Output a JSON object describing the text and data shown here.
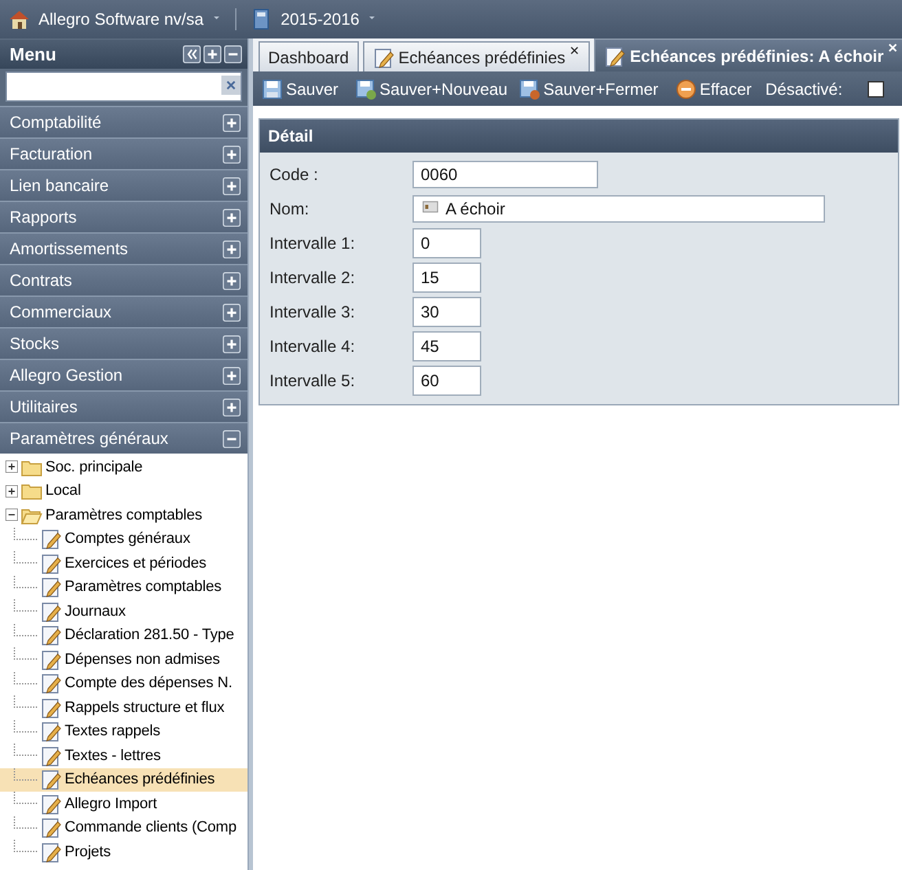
{
  "topbar": {
    "company": "Allegro Software nv/sa",
    "year": "2015-2016"
  },
  "sidebar": {
    "title": "Menu",
    "sections": [
      {
        "label": "Comptabilité",
        "expanded": false
      },
      {
        "label": "Facturation",
        "expanded": false
      },
      {
        "label": "Lien bancaire",
        "expanded": false
      },
      {
        "label": "Rapports",
        "expanded": false
      },
      {
        "label": "Amortissements",
        "expanded": false
      },
      {
        "label": "Contrats",
        "expanded": false
      },
      {
        "label": "Commerciaux",
        "expanded": false
      },
      {
        "label": "Stocks",
        "expanded": false
      },
      {
        "label": "Allegro Gestion",
        "expanded": false
      },
      {
        "label": "Utilitaires",
        "expanded": false
      },
      {
        "label": "Paramètres généraux",
        "expanded": true
      }
    ],
    "tree": [
      {
        "label": "Soc. principale",
        "kind": "folder",
        "expanded": false,
        "selected": false
      },
      {
        "label": "Local",
        "kind": "folder",
        "expanded": false,
        "selected": false
      },
      {
        "label": "Paramètres comptables",
        "kind": "folder",
        "expanded": true,
        "selected": false,
        "children": [
          {
            "label": "Comptes généraux",
            "kind": "leaf",
            "selected": false
          },
          {
            "label": "Exercices et périodes",
            "kind": "leaf",
            "selected": false
          },
          {
            "label": "Paramètres comptables",
            "kind": "leaf",
            "selected": false
          },
          {
            "label": "Journaux",
            "kind": "leaf",
            "selected": false
          },
          {
            "label": "Déclaration 281.50 - Type",
            "kind": "leaf",
            "selected": false
          },
          {
            "label": "Dépenses non admises",
            "kind": "leaf",
            "selected": false
          },
          {
            "label": "Compte des dépenses N.",
            "kind": "leaf",
            "selected": false
          },
          {
            "label": "Rappels structure et flux",
            "kind": "leaf",
            "selected": false
          },
          {
            "label": "Textes rappels",
            "kind": "leaf",
            "selected": false
          },
          {
            "label": "Textes - lettres",
            "kind": "leaf",
            "selected": false
          },
          {
            "label": "Echéances prédéfinies",
            "kind": "leaf",
            "selected": true
          },
          {
            "label": "Allegro Import",
            "kind": "leaf",
            "selected": false
          },
          {
            "label": "Commande clients (Comp",
            "kind": "leaf",
            "selected": false
          },
          {
            "label": "Projets",
            "kind": "leaf",
            "selected": false
          }
        ]
      }
    ]
  },
  "tabs": [
    {
      "label": "Dashboard",
      "selected": false,
      "closable": false
    },
    {
      "label": "Echéances prédéfinies",
      "selected": false,
      "closable": true
    },
    {
      "label": "Echéances prédéfinies: A échoir",
      "selected": true,
      "closable": true
    }
  ],
  "tabs_close": "✕",
  "toolbar": {
    "buttons": [
      {
        "label": "Sauver",
        "kind": "save"
      },
      {
        "label": "Sauver+Nouveau",
        "kind": "save-new"
      },
      {
        "label": "Sauver+Fermer",
        "kind": "save-close"
      },
      {
        "label": "Effacer",
        "kind": "delete"
      }
    ],
    "disabled_label": "Désactivé:",
    "disabled_checked": false
  },
  "detail": {
    "title": "Détail",
    "fields": [
      {
        "label": "Code :",
        "value": "0060",
        "kind": "medium"
      },
      {
        "label": "Nom:",
        "value": "A échoir",
        "kind": "wide"
      },
      {
        "label": "Intervalle 1:",
        "value": "0",
        "kind": "short"
      },
      {
        "label": "Intervalle 2:",
        "value": "15",
        "kind": "short"
      },
      {
        "label": "Intervalle 3:",
        "value": "30",
        "kind": "short"
      },
      {
        "label": "Intervalle 4:",
        "value": "45",
        "kind": "short"
      },
      {
        "label": "Intervalle 5:",
        "value": "60",
        "kind": "short"
      }
    ]
  }
}
